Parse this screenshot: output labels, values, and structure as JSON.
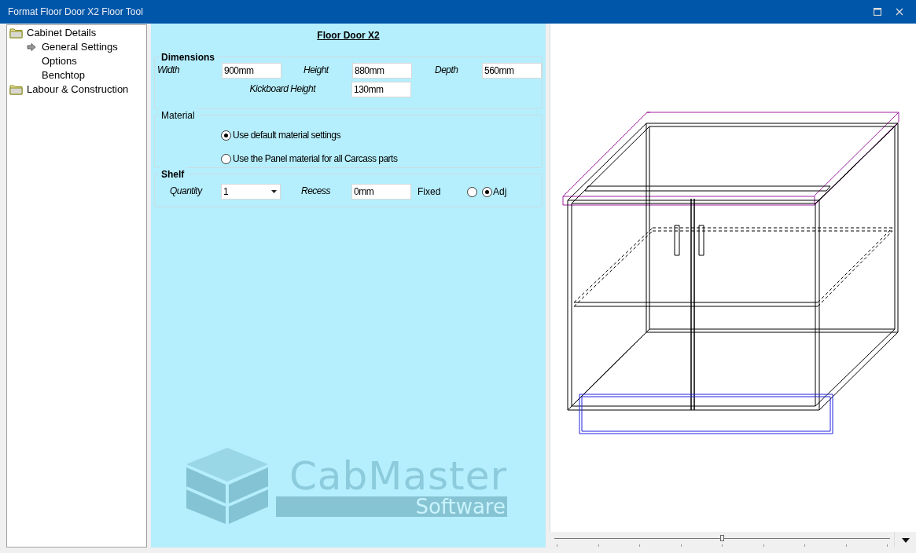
{
  "window": {
    "title": "Format Floor Door X2 Floor Tool"
  },
  "tree": [
    {
      "label": "Cabinet Details",
      "children": [
        {
          "label": "General Settings",
          "current": true
        },
        {
          "label": "Options",
          "current": false
        },
        {
          "label": "Benchtop",
          "current": false
        }
      ]
    },
    {
      "label": "Labour & Construction"
    }
  ],
  "form": {
    "title": "Floor Door X2",
    "dimensions": {
      "title": "Dimensions",
      "fields": [
        {
          "label": "Width",
          "value": "900mm"
        },
        {
          "label": "Height",
          "value": "880mm"
        },
        {
          "label": "Depth",
          "value": "560mm"
        },
        {
          "label": "Kickboard Height",
          "value": "130mm"
        }
      ]
    },
    "material": {
      "title": "Material",
      "options": [
        {
          "label": "Use default material settings",
          "selected": true
        },
        {
          "label": "Use the Panel material for all Carcass parts",
          "selected": false
        }
      ]
    },
    "shelf": {
      "title": "Shelf",
      "quantity_label": "Quantity",
      "quantity": "1",
      "recess_label": "Recess",
      "recess": "0mm",
      "options": [
        {
          "label": "Fixed",
          "selected": false
        },
        {
          "label": "Adj",
          "selected": true
        }
      ]
    },
    "logo": {
      "name": "CabMaster",
      "tagline": "Software"
    }
  },
  "viewer": {
    "zoom_slider": {
      "level": 0.5
    }
  }
}
